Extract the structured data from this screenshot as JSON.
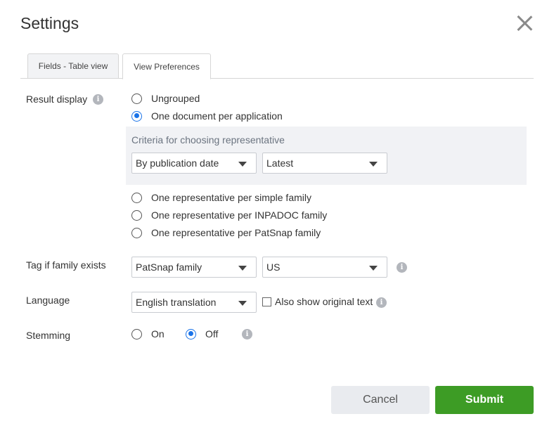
{
  "dialog": {
    "title": "Settings"
  },
  "tabs": [
    {
      "label": "Fields - Table view",
      "active": false
    },
    {
      "label": "View Preferences",
      "active": true
    }
  ],
  "result_display": {
    "label": "Result display",
    "options": [
      {
        "label": "Ungrouped",
        "checked": false
      },
      {
        "label": "One document per application",
        "checked": true
      },
      {
        "label": "One representative per simple family",
        "checked": false
      },
      {
        "label": "One representative per INPADOC family",
        "checked": false
      },
      {
        "label": "One representative per PatSnap family",
        "checked": false
      }
    ],
    "criteria": {
      "title": "Criteria for choosing representative",
      "sort_by": "By publication date",
      "order": "Latest"
    }
  },
  "tag_family": {
    "label": "Tag if family exists",
    "family_type": "PatSnap family",
    "country": "US"
  },
  "language": {
    "label": "Language",
    "value": "English translation",
    "show_original_label": "Also show original text",
    "show_original_checked": false
  },
  "stemming": {
    "label": "Stemming",
    "on_label": "On",
    "off_label": "Off",
    "value": "Off"
  },
  "footer": {
    "cancel_label": "Cancel",
    "submit_label": "Submit"
  },
  "icons": {
    "info": "info-icon",
    "close": "close-icon",
    "dropdown": "chevron-down-icon"
  },
  "colors": {
    "accent": "#1a73e8",
    "submit": "#3d9c25",
    "cancel_bg": "#e9ebef",
    "criteria_bg": "#f1f2f5"
  }
}
